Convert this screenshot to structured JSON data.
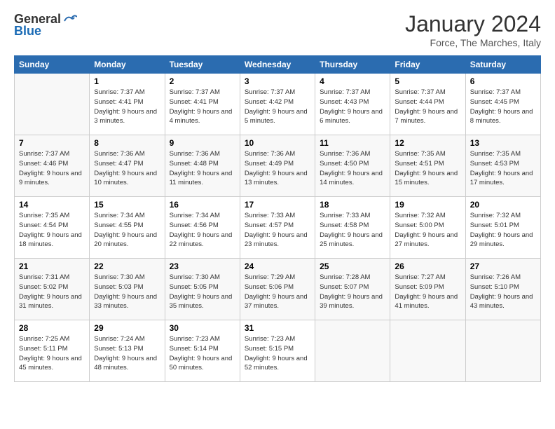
{
  "header": {
    "logo_general": "General",
    "logo_blue": "Blue",
    "title": "January 2024",
    "location": "Force, The Marches, Italy"
  },
  "days_of_week": [
    "Sunday",
    "Monday",
    "Tuesday",
    "Wednesday",
    "Thursday",
    "Friday",
    "Saturday"
  ],
  "weeks": [
    [
      {
        "day": "",
        "empty": true
      },
      {
        "day": "1",
        "sunrise": "Sunrise: 7:37 AM",
        "sunset": "Sunset: 4:41 PM",
        "daylight": "Daylight: 9 hours and 3 minutes."
      },
      {
        "day": "2",
        "sunrise": "Sunrise: 7:37 AM",
        "sunset": "Sunset: 4:41 PM",
        "daylight": "Daylight: 9 hours and 4 minutes."
      },
      {
        "day": "3",
        "sunrise": "Sunrise: 7:37 AM",
        "sunset": "Sunset: 4:42 PM",
        "daylight": "Daylight: 9 hours and 5 minutes."
      },
      {
        "day": "4",
        "sunrise": "Sunrise: 7:37 AM",
        "sunset": "Sunset: 4:43 PM",
        "daylight": "Daylight: 9 hours and 6 minutes."
      },
      {
        "day": "5",
        "sunrise": "Sunrise: 7:37 AM",
        "sunset": "Sunset: 4:44 PM",
        "daylight": "Daylight: 9 hours and 7 minutes."
      },
      {
        "day": "6",
        "sunrise": "Sunrise: 7:37 AM",
        "sunset": "Sunset: 4:45 PM",
        "daylight": "Daylight: 9 hours and 8 minutes."
      }
    ],
    [
      {
        "day": "7",
        "sunrise": "Sunrise: 7:37 AM",
        "sunset": "Sunset: 4:46 PM",
        "daylight": "Daylight: 9 hours and 9 minutes."
      },
      {
        "day": "8",
        "sunrise": "Sunrise: 7:36 AM",
        "sunset": "Sunset: 4:47 PM",
        "daylight": "Daylight: 9 hours and 10 minutes."
      },
      {
        "day": "9",
        "sunrise": "Sunrise: 7:36 AM",
        "sunset": "Sunset: 4:48 PM",
        "daylight": "Daylight: 9 hours and 11 minutes."
      },
      {
        "day": "10",
        "sunrise": "Sunrise: 7:36 AM",
        "sunset": "Sunset: 4:49 PM",
        "daylight": "Daylight: 9 hours and 13 minutes."
      },
      {
        "day": "11",
        "sunrise": "Sunrise: 7:36 AM",
        "sunset": "Sunset: 4:50 PM",
        "daylight": "Daylight: 9 hours and 14 minutes."
      },
      {
        "day": "12",
        "sunrise": "Sunrise: 7:35 AM",
        "sunset": "Sunset: 4:51 PM",
        "daylight": "Daylight: 9 hours and 15 minutes."
      },
      {
        "day": "13",
        "sunrise": "Sunrise: 7:35 AM",
        "sunset": "Sunset: 4:53 PM",
        "daylight": "Daylight: 9 hours and 17 minutes."
      }
    ],
    [
      {
        "day": "14",
        "sunrise": "Sunrise: 7:35 AM",
        "sunset": "Sunset: 4:54 PM",
        "daylight": "Daylight: 9 hours and 18 minutes."
      },
      {
        "day": "15",
        "sunrise": "Sunrise: 7:34 AM",
        "sunset": "Sunset: 4:55 PM",
        "daylight": "Daylight: 9 hours and 20 minutes."
      },
      {
        "day": "16",
        "sunrise": "Sunrise: 7:34 AM",
        "sunset": "Sunset: 4:56 PM",
        "daylight": "Daylight: 9 hours and 22 minutes."
      },
      {
        "day": "17",
        "sunrise": "Sunrise: 7:33 AM",
        "sunset": "Sunset: 4:57 PM",
        "daylight": "Daylight: 9 hours and 23 minutes."
      },
      {
        "day": "18",
        "sunrise": "Sunrise: 7:33 AM",
        "sunset": "Sunset: 4:58 PM",
        "daylight": "Daylight: 9 hours and 25 minutes."
      },
      {
        "day": "19",
        "sunrise": "Sunrise: 7:32 AM",
        "sunset": "Sunset: 5:00 PM",
        "daylight": "Daylight: 9 hours and 27 minutes."
      },
      {
        "day": "20",
        "sunrise": "Sunrise: 7:32 AM",
        "sunset": "Sunset: 5:01 PM",
        "daylight": "Daylight: 9 hours and 29 minutes."
      }
    ],
    [
      {
        "day": "21",
        "sunrise": "Sunrise: 7:31 AM",
        "sunset": "Sunset: 5:02 PM",
        "daylight": "Daylight: 9 hours and 31 minutes."
      },
      {
        "day": "22",
        "sunrise": "Sunrise: 7:30 AM",
        "sunset": "Sunset: 5:03 PM",
        "daylight": "Daylight: 9 hours and 33 minutes."
      },
      {
        "day": "23",
        "sunrise": "Sunrise: 7:30 AM",
        "sunset": "Sunset: 5:05 PM",
        "daylight": "Daylight: 9 hours and 35 minutes."
      },
      {
        "day": "24",
        "sunrise": "Sunrise: 7:29 AM",
        "sunset": "Sunset: 5:06 PM",
        "daylight": "Daylight: 9 hours and 37 minutes."
      },
      {
        "day": "25",
        "sunrise": "Sunrise: 7:28 AM",
        "sunset": "Sunset: 5:07 PM",
        "daylight": "Daylight: 9 hours and 39 minutes."
      },
      {
        "day": "26",
        "sunrise": "Sunrise: 7:27 AM",
        "sunset": "Sunset: 5:09 PM",
        "daylight": "Daylight: 9 hours and 41 minutes."
      },
      {
        "day": "27",
        "sunrise": "Sunrise: 7:26 AM",
        "sunset": "Sunset: 5:10 PM",
        "daylight": "Daylight: 9 hours and 43 minutes."
      }
    ],
    [
      {
        "day": "28",
        "sunrise": "Sunrise: 7:25 AM",
        "sunset": "Sunset: 5:11 PM",
        "daylight": "Daylight: 9 hours and 45 minutes."
      },
      {
        "day": "29",
        "sunrise": "Sunrise: 7:24 AM",
        "sunset": "Sunset: 5:13 PM",
        "daylight": "Daylight: 9 hours and 48 minutes."
      },
      {
        "day": "30",
        "sunrise": "Sunrise: 7:23 AM",
        "sunset": "Sunset: 5:14 PM",
        "daylight": "Daylight: 9 hours and 50 minutes."
      },
      {
        "day": "31",
        "sunrise": "Sunrise: 7:23 AM",
        "sunset": "Sunset: 5:15 PM",
        "daylight": "Daylight: 9 hours and 52 minutes."
      },
      {
        "day": "",
        "empty": true
      },
      {
        "day": "",
        "empty": true
      },
      {
        "day": "",
        "empty": true
      }
    ]
  ]
}
